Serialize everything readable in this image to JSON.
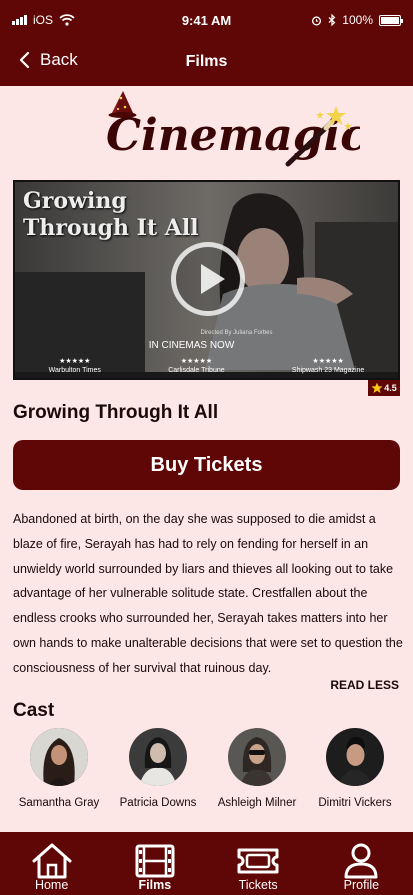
{
  "status_bar": {
    "carrier": "iOS",
    "time": "9:41 AM",
    "battery_percent": "100%"
  },
  "nav": {
    "back_label": "Back",
    "title": "Films"
  },
  "logo": {
    "text": "Cinemagic"
  },
  "hero": {
    "title_line1": "Growing",
    "title_line2": "Through It All",
    "directed_by": "Directed By Juliana Forbes",
    "tagline": "IN CINEMAS NOW",
    "reviews": [
      {
        "stars": "★★★★★",
        "source": "Warbulton Times"
      },
      {
        "stars": "★★★★★",
        "source": "Carlisdale Tribune"
      },
      {
        "stars": "★★★★★",
        "source": "Shipwash 23 Magazine"
      }
    ]
  },
  "rating": {
    "value": "4.5",
    "icon": "star-icon"
  },
  "movie": {
    "title": "Growing Through It All"
  },
  "buy_button_label": "Buy Tickets",
  "synopsis": "Abandoned at birth, on the day she was supposed to die amidst a blaze of fire, Serayah has had to rely on fending for herself in an unwieldy world surrounded by liars and thieves all looking out to take advantage of her vulnerable solitude state. Crestfallen about the endless crooks who surrounded her, Serayah takes matters into her own hands to make unalterable decisions that were set to question the consciousness of her survival that ruinous day.",
  "read_less_label": "READ LESS",
  "cast": {
    "heading": "Cast",
    "members": [
      {
        "name": "Samantha Gray"
      },
      {
        "name": "Patricia Downs"
      },
      {
        "name": "Ashleigh Milner"
      },
      {
        "name": "Dimitri Vickers"
      }
    ]
  },
  "tabs": [
    {
      "label": "Home",
      "icon": "home-icon"
    },
    {
      "label": "Films",
      "icon": "film-icon",
      "active": true
    },
    {
      "label": "Tickets",
      "icon": "ticket-icon"
    },
    {
      "label": "Profile",
      "icon": "profile-icon"
    }
  ],
  "colors": {
    "primary": "#5f0606",
    "background": "#fce6e6",
    "text": "#1a0a0a"
  }
}
